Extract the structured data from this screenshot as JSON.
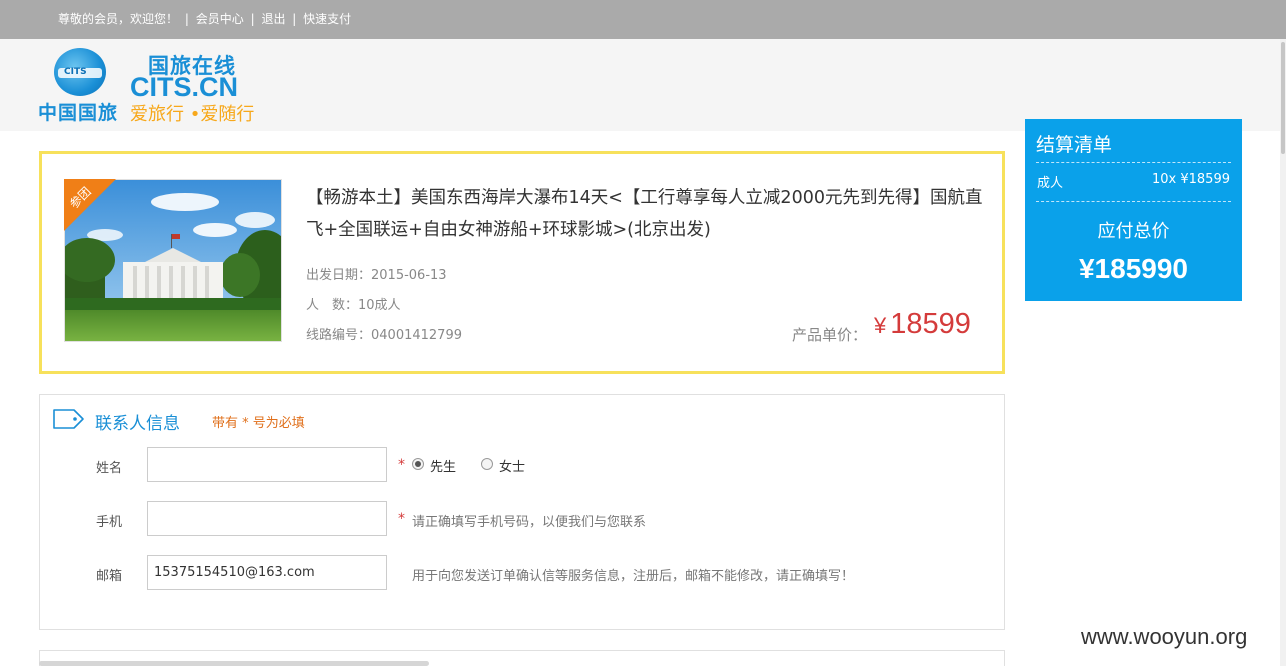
{
  "topbar": {
    "greeting": "尊敬的会员，欢迎您！",
    "sep": "|",
    "member_center": "会员中心",
    "logout": "退出",
    "quick_pay": "快速支付"
  },
  "logo": {
    "globe_text": "CITS",
    "cn_name": "中国国旅",
    "brand_cn": "国旅在线",
    "brand_en": "CITS.CN",
    "slogan": "爱旅行 •爱随行"
  },
  "product": {
    "badge": "参团",
    "title": "【畅游本土】美国东西海岸大瀑布14天<【工行尊享每人立减2000元先到先得】国航直飞+全国联运+自由女神游船+环球影城>(北京出发)",
    "departure": "出发日期：2015-06-13",
    "people": "人　数：10成人",
    "route_no": "线路编号：04001412799",
    "unit_price_label": "产品单价：",
    "currency": "¥",
    "unit_price": "18599"
  },
  "summary": {
    "title": "结算清单",
    "row_label": "成人",
    "row_value": "10x ¥18599",
    "total_label": "应付总价",
    "total": "¥185990"
  },
  "contact": {
    "section_title": "联系人信息",
    "required_note": "带有 * 号为必填",
    "name_label": "姓名",
    "name_value": "",
    "star": "*",
    "gender_male": "先生",
    "gender_female": "女士",
    "gender_selected": "先生",
    "phone_label": "手机",
    "phone_value": "",
    "phone_hint": "请正确填写手机号码，以便我们与您联系",
    "email_label": "邮箱",
    "email_value": "15375154510@163.com",
    "email_hint": "用于向您发送订单确认信等服务信息，注册后，邮箱不能修改，请正确填写！"
  },
  "watermark": "www.wooyun.org",
  "colors": {
    "accent_blue": "#0aa1ea",
    "price_red": "#d43b3b",
    "border_yellow": "#f7e15b",
    "note_orange": "#e0701c"
  }
}
